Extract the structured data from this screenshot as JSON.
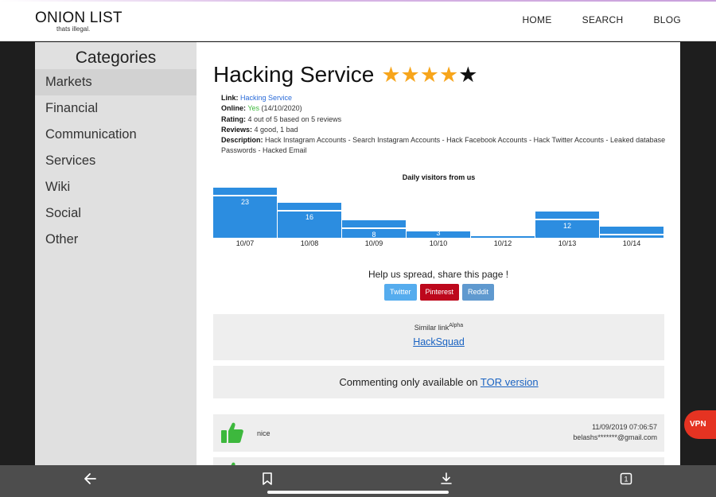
{
  "header": {
    "logo": "ONION LIST",
    "tagline": "thats illegal.",
    "nav": [
      "HOME",
      "SEARCH",
      "BLOG"
    ]
  },
  "sidebar": {
    "title": "Categories",
    "items": [
      "Markets",
      "Financial",
      "Communication",
      "Services",
      "Wiki",
      "Social",
      "Other"
    ]
  },
  "page": {
    "title": "Hacking Service",
    "rating_stars": 4,
    "max_stars": 5,
    "link_label": "Link:",
    "link_text": "Hacking Service",
    "online_label": "Online:",
    "online_status": "Yes",
    "online_date": "(14/10/2020)",
    "rating_label": "Rating:",
    "rating_text": "4 out of 5 based on 5 reviews",
    "reviews_label": "Reviews:",
    "reviews_text": "4 good, 1 bad",
    "description_label": "Description:",
    "description_text": "Hack Instagram Accounts - Search Instagram Accounts - Hack Facebook Accounts - Hack Twitter Accounts - Leaked database Passwords - Hacked Email"
  },
  "chart_data": {
    "type": "bar",
    "title": "Daily visitors from us",
    "categories": [
      "10/07",
      "10/08",
      "10/09",
      "10/10",
      "10/12",
      "10/13",
      "10/14"
    ],
    "values": [
      23,
      16,
      8,
      3,
      0,
      12,
      5
    ],
    "labels": [
      "23",
      "16",
      "8",
      "3",
      "",
      "12",
      "5"
    ],
    "ylim": [
      0,
      24
    ],
    "color": "#2c8de0"
  },
  "share": {
    "text": "Help us spread, share this page !",
    "buttons": [
      "Twitter",
      "Pinterest",
      "Reddit"
    ]
  },
  "similar": {
    "label": "Similar link",
    "sup": "Alpha",
    "link": "HackSquad"
  },
  "comment": {
    "text": "Commenting only available on",
    "link": "TOR version"
  },
  "reviews": [
    {
      "text": "nice",
      "date": "11/09/2019 07:06:57",
      "email": "belashs*******@gmail.com"
    }
  ],
  "vpn": "VPN",
  "colors": {
    "star": "#f7a51b",
    "thumb": "#3db83d",
    "link": "#1a63c2"
  },
  "icons": [
    "back-arrow-icon",
    "bookmark-icon",
    "download-icon",
    "tabs-icon",
    "thumbs-up-icon",
    "star-icon"
  ]
}
